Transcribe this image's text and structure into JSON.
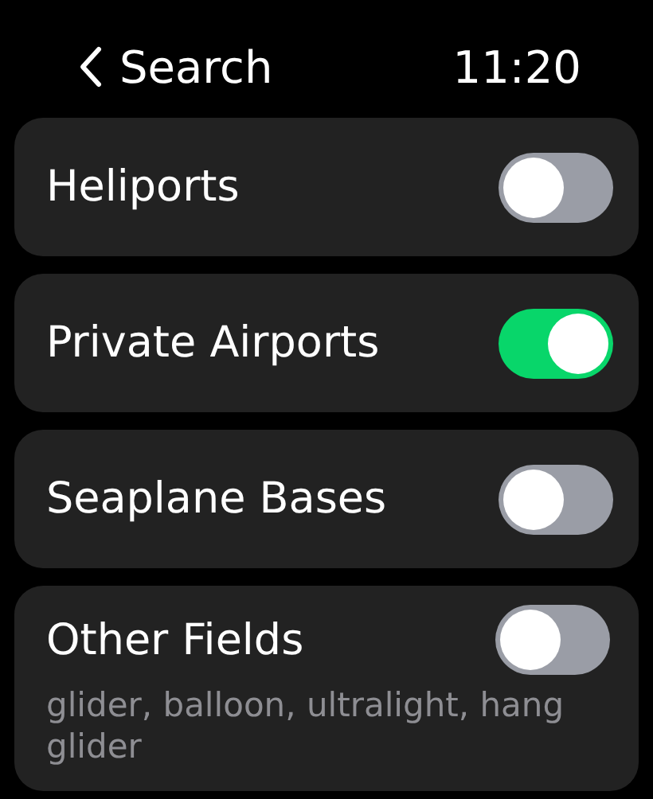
{
  "header": {
    "back_label": "Search",
    "time": "11:20"
  },
  "toggles": [
    {
      "label": "Heliports",
      "on": false
    },
    {
      "label": "Private Airports",
      "on": true
    },
    {
      "label": "Seaplane Bases",
      "on": false
    },
    {
      "label": "Other Fields",
      "on": false,
      "subtitle": "glider, balloon, ultralight, hang glider"
    }
  ]
}
